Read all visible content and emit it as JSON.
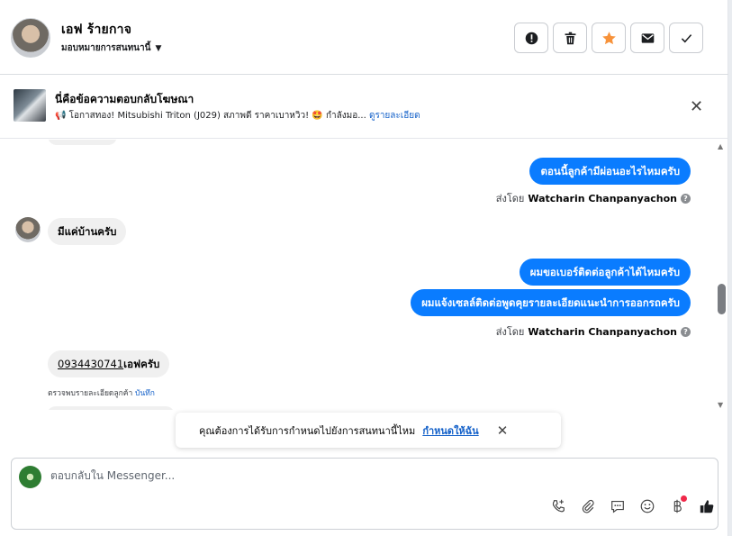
{
  "header": {
    "contact_name": "เอฟ ร้ายกาจ",
    "assign_label": "มอบหมายการสนทนานี้",
    "actions": [
      "spam-icon",
      "trash-icon",
      "star-icon",
      "envelope-icon",
      "check-icon"
    ],
    "star_color": "#f7923a"
  },
  "ad": {
    "title": "นี่คือข้อความตอบกลับโฆษณา",
    "text": "📢 โอกาสทอง! Mitsubishi Triton (J029) สภาพดี ราคาเบาหวิว! 🤩 กำลังมอ...",
    "link": "ดูรายละเอียด"
  },
  "messages": {
    "m1": "ตอนนี้ลูกค้ามีผ่อนอะไรไหมครับ",
    "m2": "มีแค่บ้านครับ",
    "m3": "ผมขอเบอร์ติดต่อลูกค้าได้ไหมครับ",
    "m4": "ผมแจ้งเซลล์ติดต่อพูดคุยรายละเอียดแนะนำการออกรถครับ",
    "m5_phone": "0934430741",
    "m5_rest": "เอฟครับ",
    "sent_prefix": "ส่งโดย",
    "sender": "Watcharin Chanpanyachon",
    "note_text": "ตรวจพบรายละเอียดลูกค้า ",
    "note_link": "บันทึก"
  },
  "toast": {
    "text": "คุณต้องการได้รับการกำหนดไปยังการสนทนานี้ไหม",
    "link": "กำหนดให้ฉัน"
  },
  "composer": {
    "placeholder": "ตอบกลับใน Messenger..."
  },
  "colors": {
    "outgoing_bubble": "#0a7cff",
    "incoming_bubble": "#f0f0f0",
    "link": "#1461c9"
  }
}
